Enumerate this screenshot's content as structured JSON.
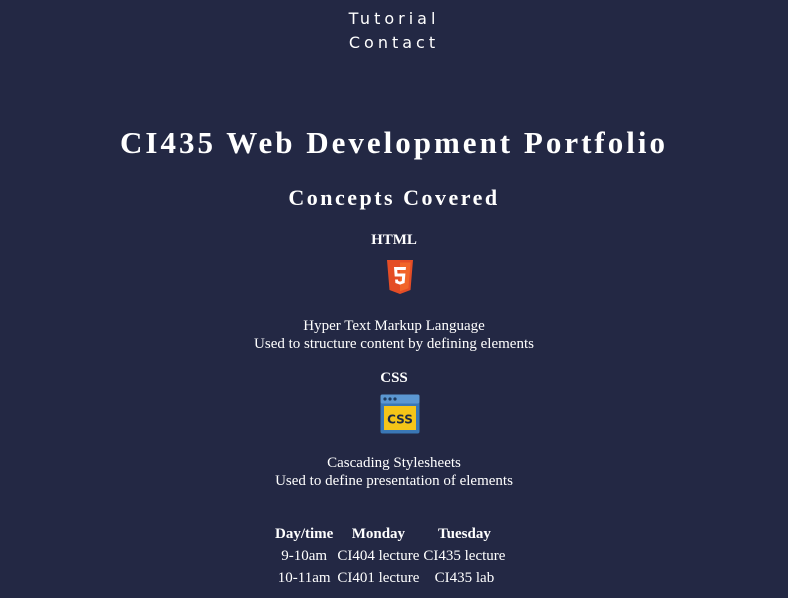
{
  "nav": {
    "links": [
      "Tutorial",
      "Contact"
    ]
  },
  "header": {
    "title": "CI435 Web Development Portfolio"
  },
  "main": {
    "section_title": "Concepts Covered",
    "concepts": [
      {
        "title": "HTML",
        "icon": "html5-icon",
        "lines": [
          "Hyper Text Markup Language",
          "Used to structure content by defining elements"
        ]
      },
      {
        "title": "CSS",
        "icon": "css-icon",
        "icon_text": "CSS",
        "lines": [
          "Cascading Stylesheets",
          "Used to define presentation of elements"
        ]
      }
    ]
  },
  "timetable": {
    "headers": [
      "Day/time",
      "Monday",
      "Tuesday"
    ],
    "rows": [
      [
        "9-10am",
        "CI404 lecture",
        "CI435 lecture"
      ],
      [
        "10-11am",
        "CI401 lecture",
        "CI435 lab"
      ]
    ]
  },
  "colors": {
    "background": "#232844",
    "html_badge": "#e44d26",
    "css_frame": "#3a77b5",
    "css_panel": "#f5c518"
  }
}
